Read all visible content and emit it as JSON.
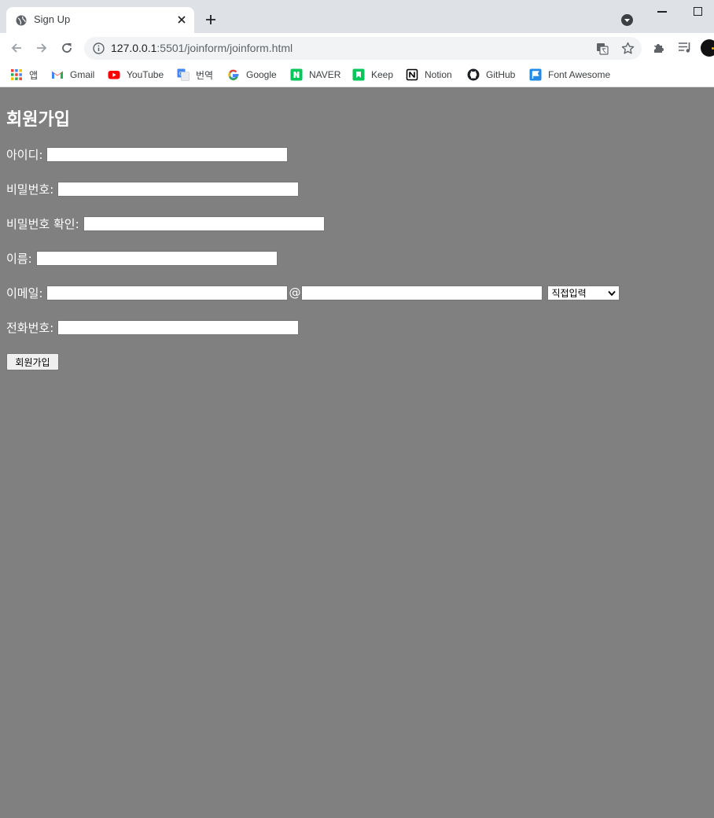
{
  "browser": {
    "tab_title": "Sign Up",
    "url_host": "127.0.0.1",
    "url_rest": ":5501/joinform/joinform.html"
  },
  "bookmarks": [
    {
      "label": "앱",
      "icon": "apps-grid-icon"
    },
    {
      "label": "Gmail",
      "icon": "gmail-icon"
    },
    {
      "label": "YouTube",
      "icon": "youtube-icon"
    },
    {
      "label": "번역",
      "icon": "google-translate-icon"
    },
    {
      "label": "Google",
      "icon": "google-icon"
    },
    {
      "label": "NAVER",
      "icon": "naver-icon"
    },
    {
      "label": "Keep",
      "icon": "keep-icon"
    },
    {
      "label": "Notion",
      "icon": "notion-icon"
    },
    {
      "label": "GitHub",
      "icon": "github-icon"
    },
    {
      "label": "Font Awesome",
      "icon": "font-awesome-icon"
    }
  ],
  "form": {
    "title": "회원가입",
    "id_label": "아이디:",
    "password_label": "비밀번호:",
    "password_confirm_label": "비밀번호 확인:",
    "name_label": "이름:",
    "email_label": "이메일:",
    "email_at": "@",
    "email_domain_select": "직접입력",
    "phone_label": "전화번호:",
    "submit_label": "회원가입"
  },
  "colors": {
    "page_background": "#808080",
    "tabstrip": "#dee1e6",
    "omnibox": "#f1f3f4"
  }
}
